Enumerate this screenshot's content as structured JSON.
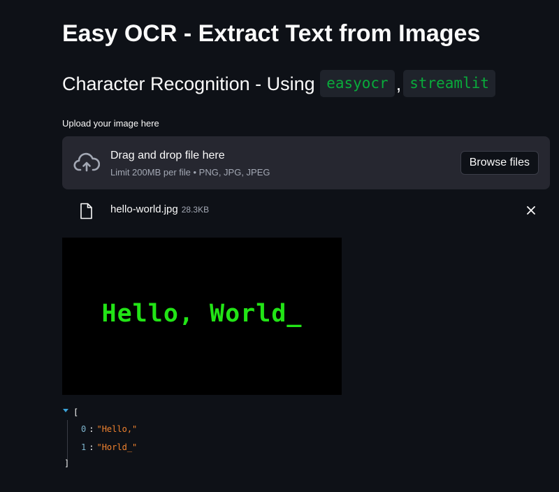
{
  "header": {
    "title": "Easy OCR - Extract Text from Images",
    "subtitle_prefix": "Character Recognition - Using",
    "chip_1": "easyocr",
    "separator": ",",
    "chip_2": "streamlit"
  },
  "uploader": {
    "label": "Upload your image here",
    "drag_text": "Drag and drop file here",
    "limit_text": "Limit 200MB per file • PNG, JPG, JPEG",
    "browse_label": "Browse files",
    "icon": "cloud-upload-icon"
  },
  "uploaded_file": {
    "name": "hello-world.jpg",
    "size": "28.3KB",
    "icon": "file-icon",
    "remove_icon": "close-icon"
  },
  "preview": {
    "text": "Hello, World_"
  },
  "result": {
    "open_bracket": "[",
    "close_bracket": "]",
    "items": [
      {
        "index": "0",
        "value": "\"Hello,\""
      },
      {
        "index": "1",
        "value": "\"Horld_\""
      }
    ]
  },
  "colors": {
    "background": "#0e1117",
    "panel": "#262730",
    "code_green": "#09ab3b",
    "json_string": "#f0822e",
    "preview_text": "#22e416"
  }
}
